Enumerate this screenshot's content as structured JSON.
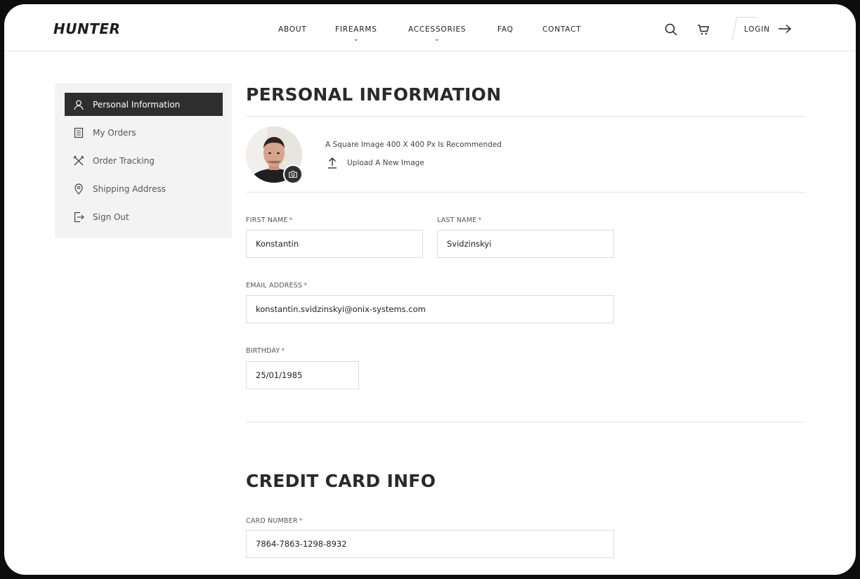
{
  "brand": {
    "logo": "HUNTER"
  },
  "nav": {
    "items": [
      {
        "label": "ABOUT"
      },
      {
        "label": "FIREARMS"
      },
      {
        "label": "ACCESSORIES"
      },
      {
        "label": "FAQ"
      },
      {
        "label": "CONTACT"
      }
    ],
    "login_label": "LOGIN",
    "icons": {
      "search": "search-icon",
      "cart": "cart-icon",
      "login": "arrow-right-icon"
    }
  },
  "sidebar": {
    "items": [
      {
        "label": "Personal Information",
        "icon": "user-icon",
        "active": true
      },
      {
        "label": "My Orders",
        "icon": "document-icon",
        "active": false
      },
      {
        "label": "Order Tracking",
        "icon": "crossed-tools-icon",
        "active": false
      },
      {
        "label": "Shipping Address",
        "icon": "map-pin-icon",
        "active": false
      },
      {
        "label": "Sign Out",
        "icon": "sign-out-icon",
        "active": false
      }
    ]
  },
  "personal": {
    "title": "PERSONAL INFORMATION",
    "image_hint": "A Square Image 400 X 400 Px Is Recommended",
    "upload_label": "Upload A New Image",
    "first_name": {
      "label": "FIRST NAME",
      "required": "*",
      "value": "Konstantin"
    },
    "last_name": {
      "label": "LAST NAME",
      "required": "*",
      "value": "Svidzinskyi"
    },
    "email": {
      "label": "EMAIL ADDRESS",
      "required": "*",
      "value": "konstantin.svidzinskyi@onix-systems.com"
    },
    "birthday": {
      "label": "BIRTHDAY",
      "required": "*",
      "value": "25/01/1985"
    }
  },
  "credit_card": {
    "title": "CREDIT CARD INFO",
    "card_number": {
      "label": "CARD NUMBER",
      "required": "*",
      "value": "7864-7863-1298-8932"
    }
  },
  "colors": {
    "active_bg": "#2e2e2e",
    "required": "#e0443c",
    "sidebar_bg": "#f3f3f3"
  }
}
